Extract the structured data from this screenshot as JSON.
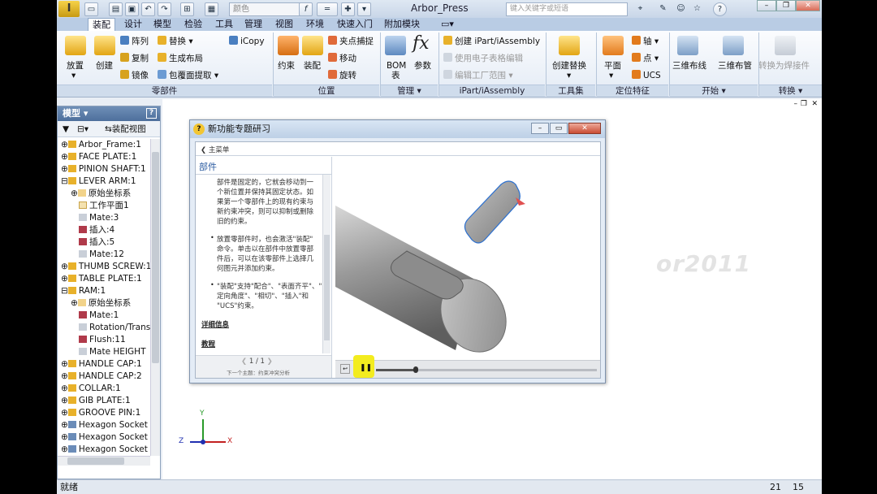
{
  "window": {
    "title": "Arbor_Press",
    "search_placeholder": "键入关键字或短语",
    "color_select": "颜色"
  },
  "ribbon": {
    "tabs": [
      "装配",
      "设计",
      "模型",
      "检验",
      "工具",
      "管理",
      "视图",
      "环境",
      "快速入门",
      "附加模块"
    ],
    "active_tab": "装配",
    "components": {
      "place": "放置",
      "create": "创建",
      "pattern": "阵列",
      "copy": "复制",
      "mirror": "镜像",
      "replace": "替换",
      "layout": "生成布局",
      "shrinkwrap": "包覆面提取",
      "icopy": "iCopy",
      "panel": "零部件"
    },
    "position": {
      "constrain": "约束",
      "assemble": "装配",
      "grip_snap": "夹点捕捉",
      "move": "移动",
      "rotate": "旋转",
      "panel": "位置"
    },
    "manage": {
      "bom": "BOM",
      "bom2": "表",
      "parameters": "参数",
      "panel": "管理"
    },
    "ipart": {
      "create": "创建 iPart/iAssembly",
      "edit_table": "使用电子表格编辑",
      "edit_factory": "编辑工厂范围",
      "panel": "iPart/iAssembly"
    },
    "productivity": {
      "create_substitute": "创建替换",
      "panel": "工具集"
    },
    "work_features": {
      "plane": "平面",
      "axis": "轴",
      "point": "点",
      "ucs": "UCS",
      "panel": "定位特征"
    },
    "begin": {
      "cable": "三维布线",
      "tube": "三维布管",
      "panel": "开始"
    },
    "convert": {
      "weldment": "转换为焊接件",
      "panel": "转换"
    }
  },
  "model_panel": {
    "title": "模型",
    "view": "装配视图",
    "tree": [
      "Arbor_Frame:1",
      "FACE PLATE:1",
      "PINION SHAFT:1",
      "LEVER ARM:1",
      "原始坐标系",
      "工作平面1",
      "Mate:3",
      "插入:4",
      "插入:5",
      "Mate:12",
      "THUMB SCREW:1",
      "TABLE PLATE:1",
      "RAM:1",
      "原始坐标系",
      "Mate:1",
      "Rotation/Transl",
      "Flush:11",
      "Mate HEIGHT",
      "HANDLE CAP:1",
      "HANDLE CAP:2",
      "COLLAR:1",
      "GIB PLATE:1",
      "GROOVE PIN:1",
      "Hexagon Socket H",
      "Hexagon Socket H",
      "Hexagon Socket H"
    ]
  },
  "dialog": {
    "title": "新功能专题研习",
    "back": "主菜单",
    "section": "部件",
    "para1": [
      "部件是固定的，它就会移动到一",
      "个新位置并保持其固定状态。如",
      "果第一个零部件上的现有约束与",
      "新约束冲突，则可以抑制或删除",
      "旧的约束。"
    ],
    "para2": [
      "放置零部件时，也会激活\"装配\"",
      "命令。单击以在部件中放置零部",
      "件后，可以在该零部件上选择几",
      "何图元并添加约束。"
    ],
    "para3": [
      "\"装配\"支持\"配合\"、\"表面齐平\"、\"",
      "定向角度\"、\"相切\"、\"插入\"和",
      "\"UCS\"约束。"
    ],
    "details": "详细信息",
    "tutorial": "教程",
    "page": "1 / 1",
    "next_topic": "下一个主题：约束冲突分析"
  },
  "watermark": "or2011",
  "axes": {
    "x": "X",
    "y": "Y",
    "z": "Z"
  },
  "status": {
    "text": "就绪",
    "n1": "21",
    "n2": "15"
  }
}
